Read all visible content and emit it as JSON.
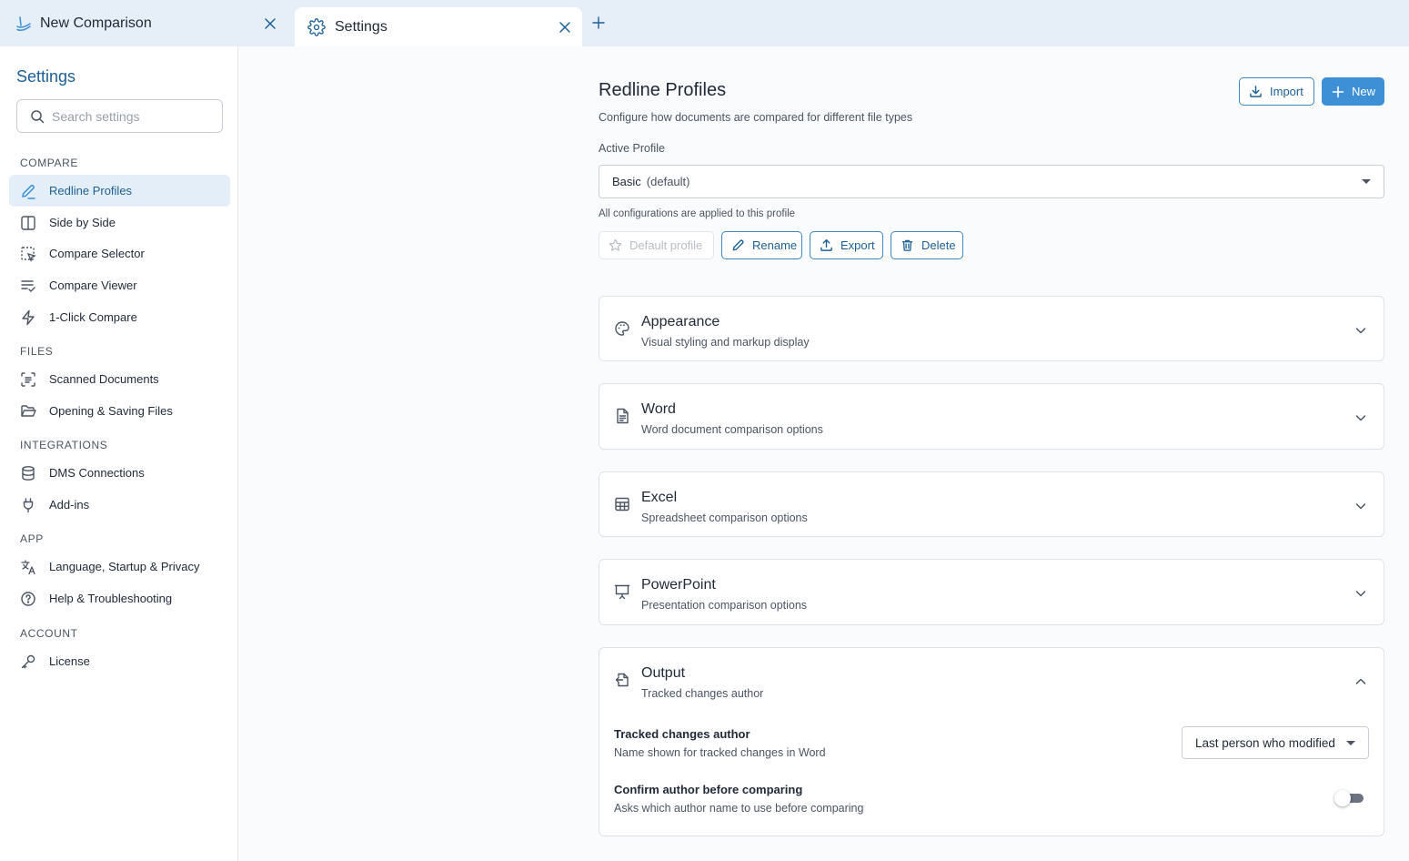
{
  "tabs": [
    {
      "label": "New Comparison",
      "icon": "app-logo-icon"
    },
    {
      "label": "Settings",
      "icon": "gear-icon"
    }
  ],
  "sidebar": {
    "title": "Settings",
    "search_placeholder": "Search settings",
    "sections": {
      "compare": "COMPARE",
      "files": "FILES",
      "integrations": "INTEGRATIONS",
      "app": "APP",
      "account": "ACCOUNT"
    },
    "items": [
      {
        "label": "Redline Profiles",
        "icon": "pencil-icon",
        "active": true
      },
      {
        "label": "Side by Side",
        "icon": "columns-icon"
      },
      {
        "label": "Compare Selector",
        "icon": "selection-cursor-icon"
      },
      {
        "label": "Compare Viewer",
        "icon": "list-check-icon"
      },
      {
        "label": "1-Click Compare",
        "icon": "lightning-icon"
      },
      {
        "label": "Scanned Documents",
        "icon": "scan-text-icon"
      },
      {
        "label": "Opening & Saving Files",
        "icon": "folder-open-icon"
      },
      {
        "label": "DMS Connections",
        "icon": "database-icon"
      },
      {
        "label": "Add-ins",
        "icon": "plug-icon"
      },
      {
        "label": "Language, Startup & Privacy",
        "icon": "translate-icon"
      },
      {
        "label": "Help & Troubleshooting",
        "icon": "help-circle-icon"
      },
      {
        "label": "License",
        "icon": "key-icon"
      }
    ]
  },
  "main": {
    "title": "Redline Profiles",
    "subtitle": "Configure how documents are compared for different file types",
    "import_label": "Import",
    "new_label": "New",
    "active_profile_label": "Active Profile",
    "active_profile_name": "Basic",
    "active_profile_tag": "(default)",
    "applied_note": "All configurations are applied to this profile",
    "actions": {
      "default": "Default profile",
      "rename": "Rename",
      "export": "Export",
      "delete": "Delete"
    },
    "cards": [
      {
        "title": "Appearance",
        "subtitle": "Visual styling and markup display",
        "icon": "palette-icon",
        "expanded": false
      },
      {
        "title": "Word",
        "subtitle": "Word document comparison options",
        "icon": "document-icon",
        "expanded": false
      },
      {
        "title": "Excel",
        "subtitle": "Spreadsheet comparison options",
        "icon": "table-icon",
        "expanded": false
      },
      {
        "title": "PowerPoint",
        "subtitle": "Presentation comparison options",
        "icon": "presentation-icon",
        "expanded": false
      },
      {
        "title": "Output",
        "subtitle": "Tracked changes author",
        "icon": "export-file-icon",
        "expanded": true
      }
    ],
    "output": {
      "author_title": "Tracked changes author",
      "author_sub": "Name shown for tracked changes in Word",
      "author_value": "Last person who modified",
      "confirm_title": "Confirm author before comparing",
      "confirm_sub": "Asks which author name to use before comparing",
      "confirm_enabled": false
    }
  },
  "colors": {
    "accent": "#3d8fd6",
    "accent_dark": "#1d5f96",
    "tabbar_bg": "#e6eff8",
    "active_item_bg": "#e4eef8"
  }
}
